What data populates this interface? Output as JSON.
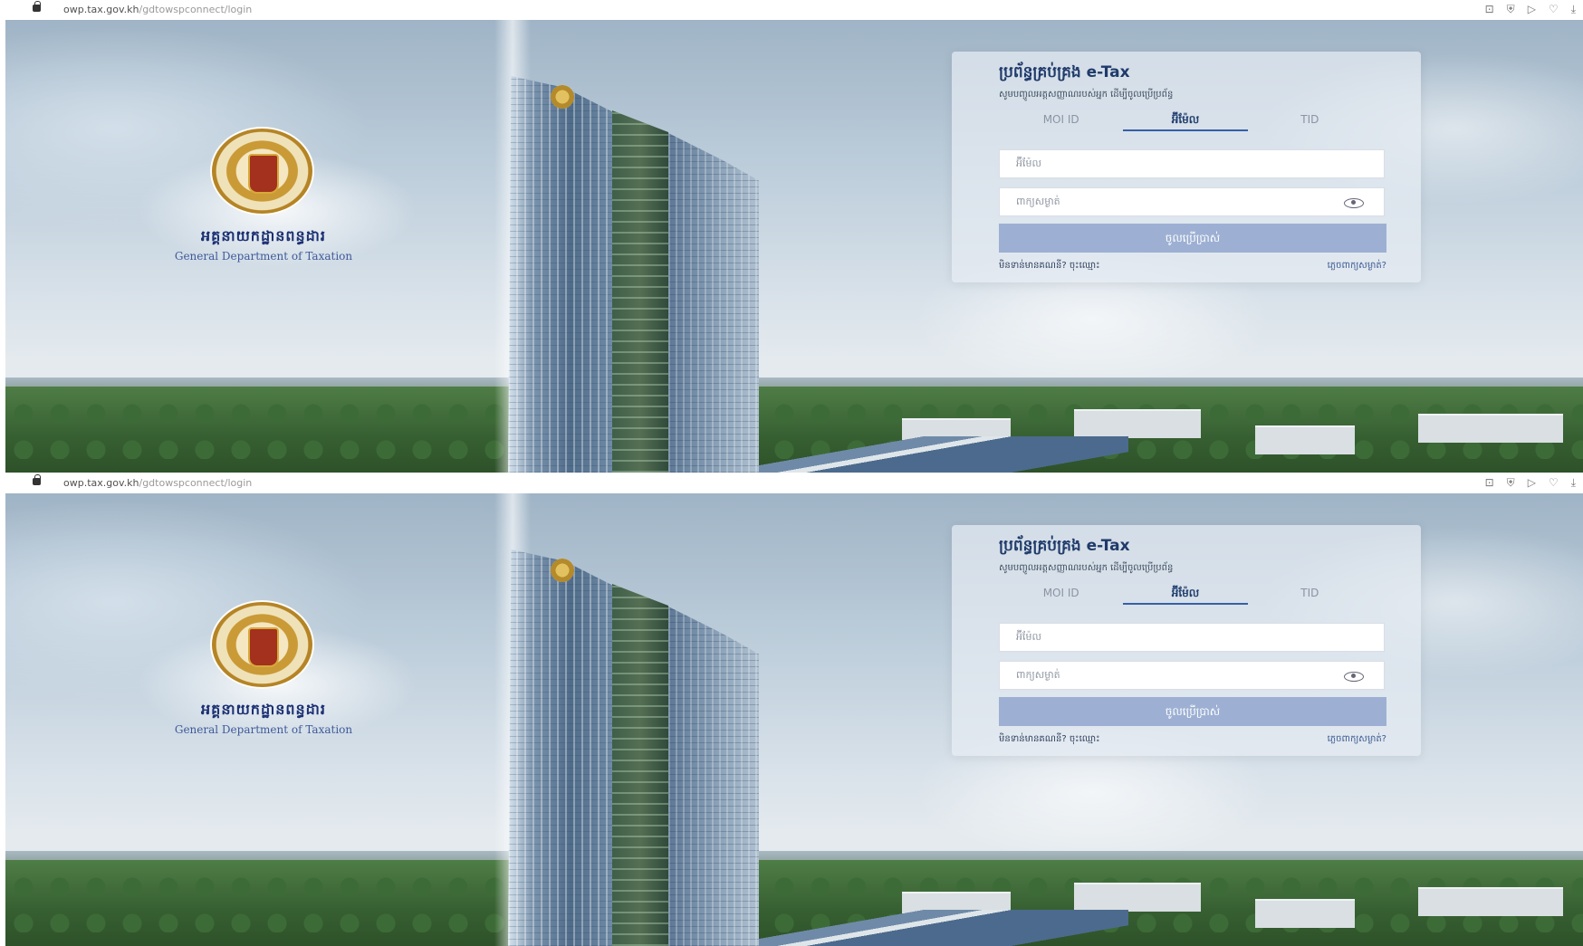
{
  "browser": {
    "url_domain": "owp.tax.gov.kh",
    "url_path": "/gdtowspconnect/login",
    "toolbar_icons": [
      "screenshot-icon",
      "shield-icon",
      "send-icon",
      "heart-icon",
      "download-icon"
    ]
  },
  "brand": {
    "name_kh": "អគ្គនាយកដ្ឋានពន្ធដារ",
    "name_en": "General Department of Taxation"
  },
  "login": {
    "title": "ប្រព័ន្ធគ្រប់គ្រង e-Tax",
    "description": "សូមបញ្ចូលអត្តសញ្ញាណរបស់អ្នក ដើម្បីចូលប្រើប្រព័ន្ធ",
    "tabs": [
      "MOI ID",
      "អ៊ីម៉ែល",
      "TID"
    ],
    "active_tab": "អ៊ីម៉ែល",
    "email_placeholder": "អ៊ីម៉ែល",
    "password_placeholder": "ពាក្យសម្ងាត់",
    "submit_label": "ចូលប្រើប្រាស់",
    "register_link": "មិនទាន់មានគណនី? ចុះឈ្មោះ",
    "forgot_link": "ភ្លេចពាក្យសម្ងាត់?"
  },
  "colors": {
    "title": "#1f3a6b",
    "button": "#9db0d3",
    "tab_active": "#3460a6"
  }
}
